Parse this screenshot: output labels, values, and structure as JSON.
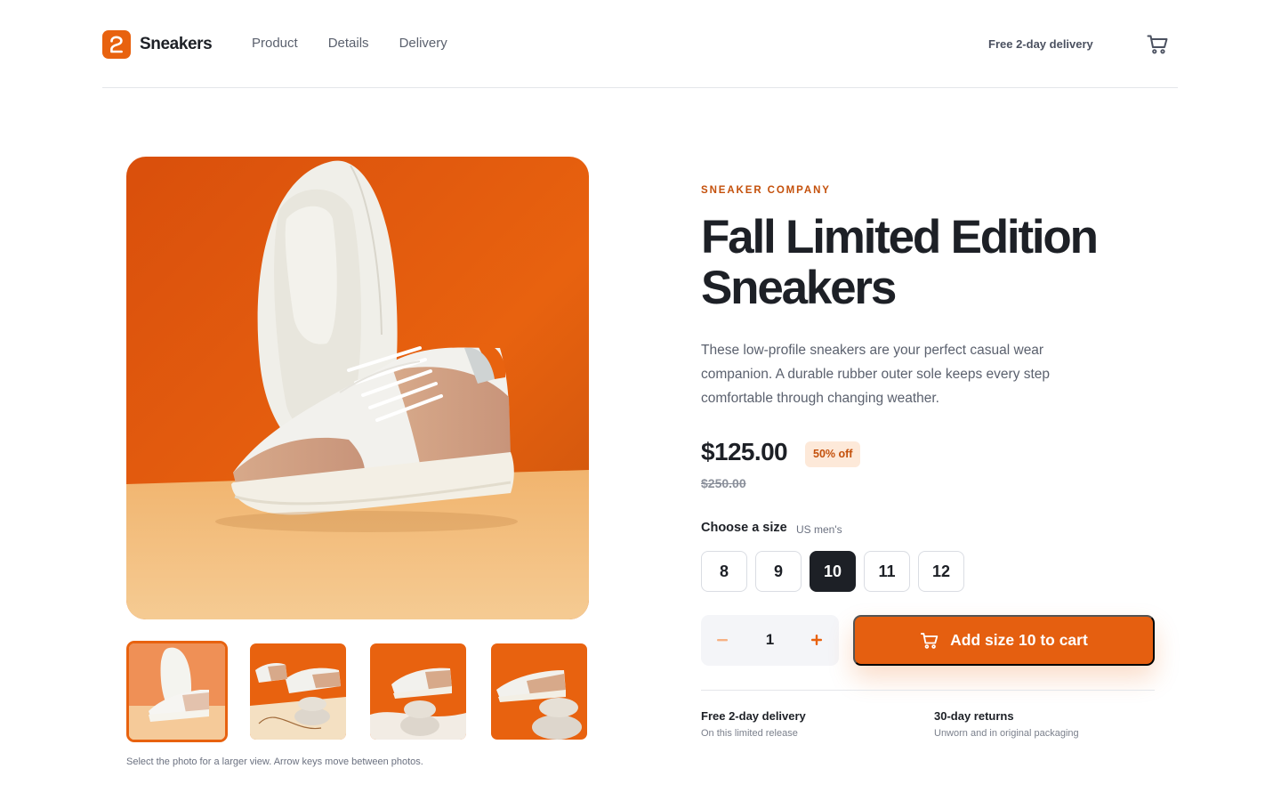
{
  "brand": {
    "name": "Sneakers",
    "accent": "#e8620f"
  },
  "nav": {
    "items": [
      "Product",
      "Details",
      "Delivery"
    ]
  },
  "header": {
    "delivery_note": "Free 2-day delivery",
    "cart_icon": "cart-icon"
  },
  "gallery": {
    "selected_index": 0,
    "thumbnail_count": 4,
    "hint": "Select the photo for a larger view. Arrow keys move between photos."
  },
  "product": {
    "company": "SNEAKER COMPANY",
    "title": "Fall Limited Edition Sneakers",
    "description": "These low-profile sneakers are your perfect casual wear companion. A durable rubber outer sole keeps every step comfortable through changing weather.",
    "price": "$125.00",
    "discount": "50% off",
    "original_price": "$250.00"
  },
  "sizes": {
    "label": "Choose a size",
    "unit": "US men's",
    "options": [
      "8",
      "9",
      "10",
      "11",
      "12"
    ],
    "selected": "10"
  },
  "quantity": {
    "value": "1",
    "decrement_icon": "minus-icon",
    "increment_icon": "plus-icon"
  },
  "cart_button": {
    "label": "Add size 10 to cart",
    "icon": "cart-icon"
  },
  "features": [
    {
      "title": "Free 2-day delivery",
      "subtitle": "On this limited release"
    },
    {
      "title": "30-day returns",
      "subtitle": "Unworn and in original packaging"
    }
  ],
  "colors": {
    "accent": "#e8620f",
    "text": "#1d2026",
    "muted": "#5b616e",
    "badge_bg": "#fde9d9"
  }
}
